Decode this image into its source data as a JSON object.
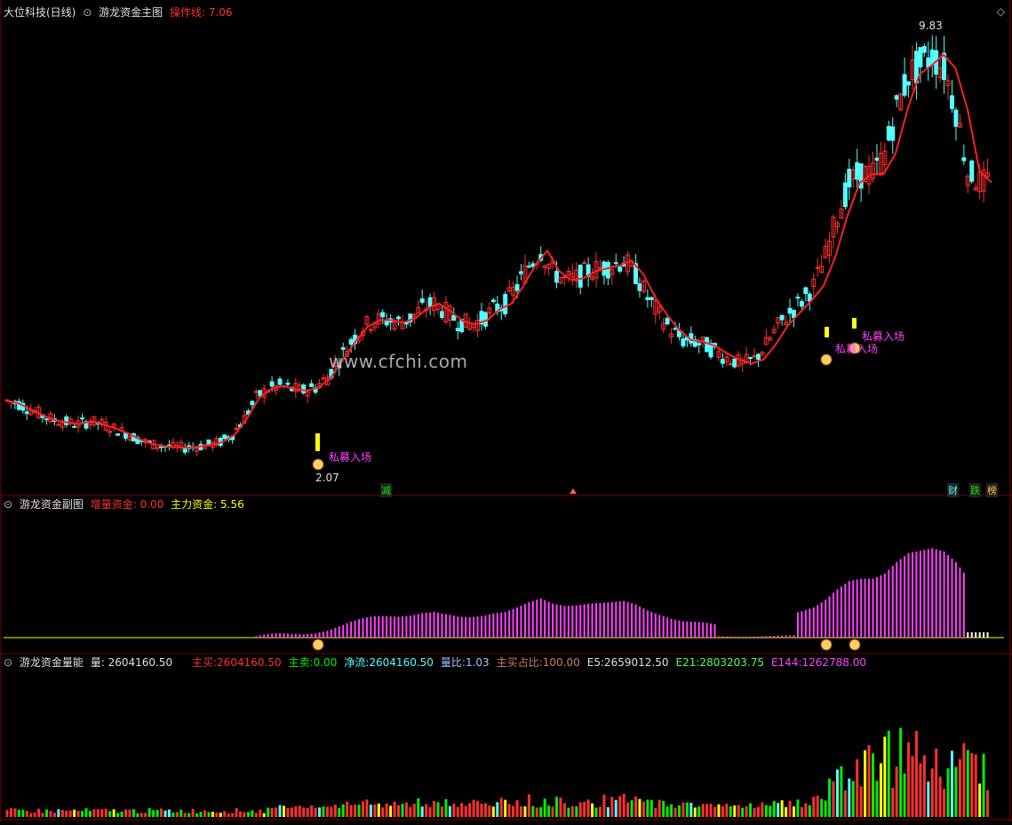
{
  "colors": {
    "up": "#ff3030",
    "down": "#54ffff",
    "ma": "#ff2020",
    "grid": "#7a0000",
    "label": "#e0e0e0",
    "magenta": "#ff40ff",
    "yellow": "#ffff00",
    "green": "#00ee00"
  },
  "watermark": "www.cfchi.com",
  "main": {
    "title": "大位科技(日线)",
    "indicator": "游龙资金主图",
    "line_label": "操作线:",
    "line_value": "7.06",
    "high_label": "9.83",
    "low_label": "2.07",
    "signal_text": "私募入场",
    "marks": [
      "减",
      "财",
      "跌",
      "榜"
    ]
  },
  "sub1": {
    "indicator": "游龙资金副图",
    "inc_label": "增量资金:",
    "inc_value": "0.00",
    "main_label": "主力资金:",
    "main_value": "5.56"
  },
  "sub2": {
    "indicator": "游龙资金量能",
    "vol_label": "量:",
    "vol_value": "2604160.50",
    "items": [
      {
        "label": "主买:",
        "value": "2604160.50",
        "color": "#ff3030"
      },
      {
        "label": "主卖:",
        "value": "0.00",
        "color": "#00ee00"
      },
      {
        "label": "净流:",
        "value": "2604160.50",
        "color": "#54ffff"
      },
      {
        "label": "量比:",
        "value": "1.03",
        "color": "#a0c8ff"
      },
      {
        "label": "主买占比:",
        "value": "100.00",
        "color": "#d08060"
      },
      {
        "label": "E5:",
        "value": "2659012.50",
        "color": "#e0e0e0"
      },
      {
        "label": "E21:",
        "value": "2803203.75",
        "color": "#54ff54"
      },
      {
        "label": "E144:",
        "value": "1262788.00",
        "color": "#ff40ff"
      }
    ]
  },
  "chart_data": {
    "type": "line",
    "title": "大位科技(日线)",
    "ylim": [
      2.07,
      9.83
    ],
    "series": [
      {
        "name": "操作线",
        "values": [
          3.35,
          3.3,
          3.2,
          3.1,
          3.02,
          2.98,
          2.95,
          3.0,
          2.95,
          2.88,
          2.8,
          2.7,
          2.62,
          2.58,
          2.56,
          2.55,
          2.57,
          2.6,
          2.65,
          2.78,
          3.05,
          3.4,
          3.55,
          3.6,
          3.55,
          3.52,
          3.58,
          3.75,
          4.05,
          4.35,
          4.6,
          4.72,
          4.72,
          4.68,
          4.75,
          4.92,
          5.0,
          4.86,
          4.7,
          4.65,
          4.72,
          4.9,
          5.0,
          5.3,
          5.65,
          5.9,
          5.55,
          5.4,
          5.43,
          5.55,
          5.6,
          5.65,
          5.73,
          5.5,
          5.1,
          4.8,
          4.55,
          4.38,
          4.35,
          4.28,
          4.15,
          4.05,
          3.98,
          4.05,
          4.3,
          4.62,
          4.84,
          5.05,
          5.3,
          5.8,
          6.5,
          7.05,
          7.2,
          7.2,
          7.55,
          8.3,
          8.9,
          9.05,
          9.23,
          9.0,
          8.3,
          7.25,
          7.06
        ]
      }
    ]
  }
}
